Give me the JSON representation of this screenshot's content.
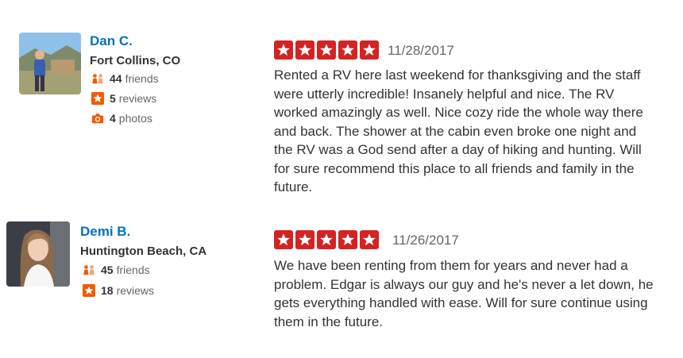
{
  "reviews": [
    {
      "user": {
        "name": "Dan C.",
        "location": "Fort Collins, CO",
        "friends_count": "44",
        "friends_label": "friends",
        "reviews_count": "5",
        "reviews_label": "reviews",
        "photos_count": "4",
        "photos_label": "photos"
      },
      "rating": 5,
      "date": "11/28/2017",
      "text": "Rented a RV here last weekend for thanksgiving and the staff were utterly incredible! Insanely helpful and nice. The RV worked amazingly as well. Nice cozy ride the whole way there and back. The shower at the cabin even broke one night and the RV was a God send after a day of hiking and hunting. Will for sure recommend this place to all friends and family in the future."
    },
    {
      "user": {
        "name": "Demi B.",
        "location": "Huntington Beach, CA",
        "friends_count": "45",
        "friends_label": "friends",
        "reviews_count": "18",
        "reviews_label": "reviews"
      },
      "rating": 5,
      "date": "11/26/2017",
      "text": "We have been renting from them for years and never had a problem. Edgar is always our guy and he's never a let down, he gets everything handled with ease. Will for sure continue using them in the future."
    }
  ],
  "colors": {
    "star_red": "#d32323",
    "link_blue": "#0073bb",
    "icon_orange": "#f15c00"
  },
  "icons": {
    "friends": "friends-icon",
    "reviews": "review-star-icon",
    "photos": "camera-icon",
    "rating": "star-icon"
  }
}
